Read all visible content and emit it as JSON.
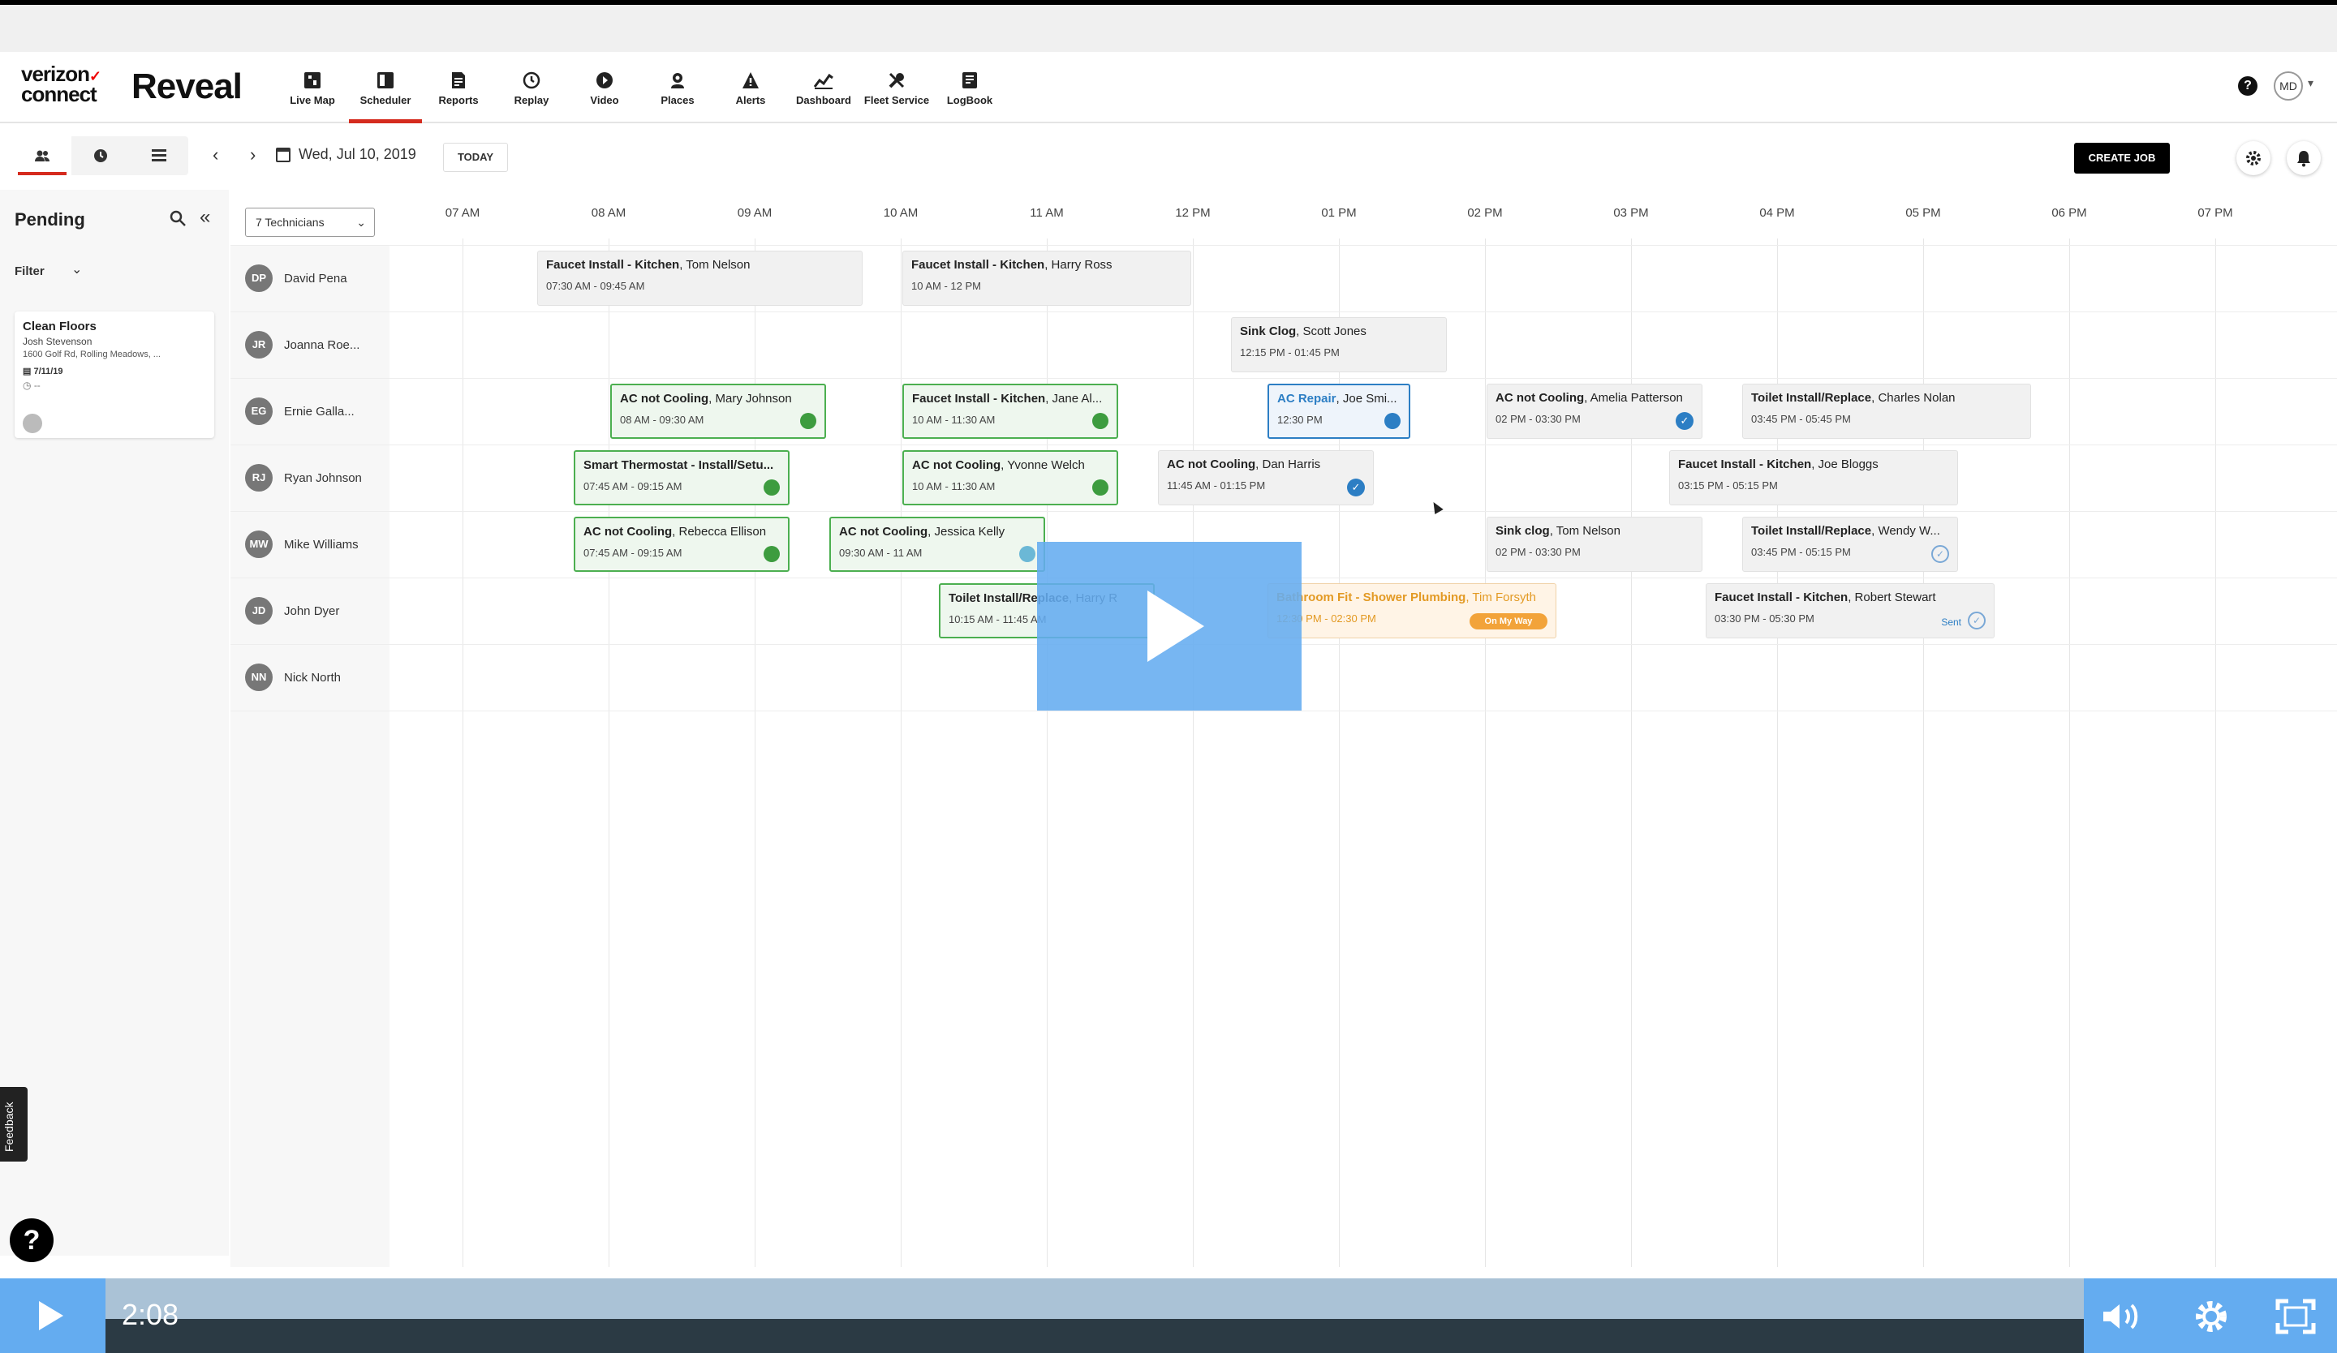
{
  "app": {
    "brand_line1": "verizon",
    "brand_line2": "connect",
    "product": "Reveal",
    "avatar_initials": "MD",
    "help_glyph": "?"
  },
  "nav": [
    {
      "label": "Live Map",
      "icon": "map-icon"
    },
    {
      "label": "Scheduler",
      "icon": "scheduler-icon",
      "active": true
    },
    {
      "label": "Reports",
      "icon": "report-icon"
    },
    {
      "label": "Replay",
      "icon": "replay-icon"
    },
    {
      "label": "Video",
      "icon": "video-icon"
    },
    {
      "label": "Places",
      "icon": "places-icon"
    },
    {
      "label": "Alerts",
      "icon": "alert-icon"
    },
    {
      "label": "Dashboard",
      "icon": "dashboard-icon"
    },
    {
      "label": "Fleet Service",
      "icon": "wrench-icon"
    },
    {
      "label": "LogBook",
      "icon": "logbook-icon"
    }
  ],
  "toolbar": {
    "date": "Wed, Jul 10, 2019",
    "today_label": "TODAY",
    "create_label": "CREATE JOB"
  },
  "pending": {
    "title": "Pending",
    "filter_label": "Filter",
    "card": {
      "title": "Clean Floors",
      "customer": "Josh Stevenson",
      "address": "1600 Golf Rd, Rolling Meadows, ...",
      "date": "7/11/19",
      "duration": "--"
    }
  },
  "scheduler": {
    "technicians_select": "7 Technicians",
    "hours": [
      "07 AM",
      "08 AM",
      "09 AM",
      "10 AM",
      "11 AM",
      "12 PM",
      "01 PM",
      "02 PM",
      "03 PM",
      "04 PM",
      "05 PM",
      "06 PM",
      "07 PM"
    ],
    "technicians": [
      {
        "initials": "DP",
        "name": "David Pena"
      },
      {
        "initials": "JR",
        "name": "Joanna Roe..."
      },
      {
        "initials": "EG",
        "name": "Ernie Galla..."
      },
      {
        "initials": "RJ",
        "name": "Ryan Johnson"
      },
      {
        "initials": "MW",
        "name": "Mike Williams"
      },
      {
        "initials": "JD",
        "name": "John Dyer"
      },
      {
        "initials": "NN",
        "name": "Nick North"
      }
    ],
    "jobs": [
      {
        "row": 0,
        "start": 7.5,
        "end": 9.75,
        "style": "gray",
        "title": "Faucet Install - Kitchen",
        "customer": "Tom Nelson",
        "time": "07:30 AM - 09:45 AM"
      },
      {
        "row": 0,
        "start": 10,
        "end": 12,
        "style": "gray",
        "title": "Faucet Install - Kitchen",
        "customer": "Harry Ross",
        "time": "10 AM - 12 PM"
      },
      {
        "row": 1,
        "start": 12.25,
        "end": 13.75,
        "style": "gray",
        "title": "Sink Clog",
        "customer": "Scott Jones",
        "time": "12:15 PM - 01:45 PM"
      },
      {
        "row": 2,
        "start": 8,
        "end": 9.5,
        "style": "green",
        "title": "AC not Cooling",
        "customer": "Mary Johnson",
        "time": "08 AM - 09:30 AM",
        "marker": "dot-green"
      },
      {
        "row": 2,
        "start": 10,
        "end": 11.5,
        "style": "green",
        "title": "Faucet Install - Kitchen",
        "customer": "Jane Al...",
        "time": "10 AM - 11:30 AM",
        "marker": "dot-green"
      },
      {
        "row": 2,
        "start": 12.5,
        "end": 13.5,
        "style": "blue",
        "title": "AC Repair",
        "customer": "Joe Smi...",
        "time": "12:30 PM",
        "marker": "dot-blue"
      },
      {
        "row": 2,
        "start": 14,
        "end": 15.5,
        "style": "gray",
        "title": "AC not Cooling",
        "customer": "Amelia Patterson",
        "time": "02 PM - 03:30 PM",
        "marker": "check-blue"
      },
      {
        "row": 2,
        "start": 15.75,
        "end": 17.75,
        "style": "gray",
        "title": "Toilet Install/Replace",
        "customer": "Charles Nolan",
        "time": "03:45 PM - 05:45 PM"
      },
      {
        "row": 3,
        "start": 7.75,
        "end": 9.25,
        "style": "green",
        "title": "Smart Thermostat - Install/Setu...",
        "customer": "",
        "time": "07:45 AM - 09:15 AM",
        "marker": "dot-green"
      },
      {
        "row": 3,
        "start": 10,
        "end": 11.5,
        "style": "green",
        "title": "AC not Cooling",
        "customer": "Yvonne Welch",
        "time": "10 AM - 11:30 AM",
        "marker": "dot-green"
      },
      {
        "row": 3,
        "start": 11.75,
        "end": 13.25,
        "style": "gray",
        "title": "AC not Cooling",
        "customer": "Dan Harris",
        "time": "11:45 AM - 01:15 PM",
        "marker": "check-blue"
      },
      {
        "row": 3,
        "start": 15.25,
        "end": 17.25,
        "style": "gray",
        "title": "Faucet Install - Kitchen",
        "customer": "Joe Bloggs",
        "time": "03:15 PM - 05:15 PM"
      },
      {
        "row": 4,
        "start": 7.75,
        "end": 9.25,
        "style": "green",
        "title": "AC not Cooling",
        "customer": "Rebecca Ellison",
        "time": "07:45 AM - 09:15 AM",
        "marker": "dot-green"
      },
      {
        "row": 4,
        "start": 9.5,
        "end": 11,
        "style": "green",
        "title": "AC not Cooling",
        "customer": "Jessica Kelly",
        "time": "09:30 AM - 11 AM",
        "marker": "dot-teal"
      },
      {
        "row": 4,
        "start": 14,
        "end": 15.5,
        "style": "gray",
        "title": "Sink clog",
        "customer": "Tom Nelson",
        "time": "02 PM - 03:30 PM"
      },
      {
        "row": 4,
        "start": 15.75,
        "end": 17.25,
        "style": "gray",
        "title": "Toilet Install/Replace",
        "customer": "Wendy W...",
        "time": "03:45 PM - 05:15 PM",
        "marker": "check-outline"
      },
      {
        "row": 5,
        "start": 10.25,
        "end": 11.75,
        "style": "green",
        "title": "Toilet Install/Replace",
        "customer": "Harry R",
        "time": "10:15 AM - 11:45 AM"
      },
      {
        "row": 5,
        "start": 12.5,
        "end": 14.5,
        "style": "orange",
        "title": "Bathroom Fit - Shower Plumbing",
        "customer": "Tim Forsyth",
        "time": "12:30 PM - 02:30 PM",
        "status": "On My Way"
      },
      {
        "row": 5,
        "start": 15.5,
        "end": 17.5,
        "style": "gray",
        "title": "Faucet Install - Kitchen",
        "customer": "Robert Stewart",
        "time": "03:30 PM - 05:30 PM",
        "marker": "check-outline",
        "status_text": "Sent"
      }
    ]
  },
  "feedback_label": "Feedback",
  "video": {
    "time": "2:08"
  },
  "colors": {
    "accent": "#d52b1e",
    "video_blue": "#64acf0",
    "job_green": "#4caf50",
    "job_blue": "#2c7ec4",
    "job_orange": "#f2a33a"
  }
}
